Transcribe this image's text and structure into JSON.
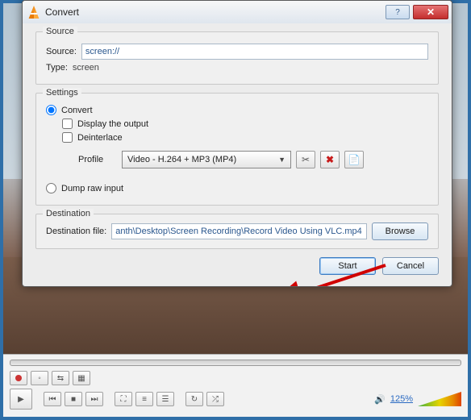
{
  "dialog": {
    "title": "Convert",
    "source_group": {
      "legend": "Source",
      "source_label": "Source:",
      "source_value": "screen://",
      "type_label": "Type:",
      "type_value": "screen"
    },
    "settings_group": {
      "legend": "Settings",
      "convert_label": "Convert",
      "display_output_label": "Display the output",
      "deinterlace_label": "Deinterlace",
      "profile_label": "Profile",
      "profile_value": "Video - H.264 + MP3 (MP4)",
      "dump_label": "Dump raw input"
    },
    "destination_group": {
      "legend": "Destination",
      "dest_label": "Destination file:",
      "dest_value": "anth\\Desktop\\Screen Recording\\Record Video Using VLC.mp4",
      "browse_label": "Browse"
    },
    "footer": {
      "start_label": "Start",
      "cancel_label": "Cancel"
    }
  },
  "player": {
    "volume": "125%"
  }
}
